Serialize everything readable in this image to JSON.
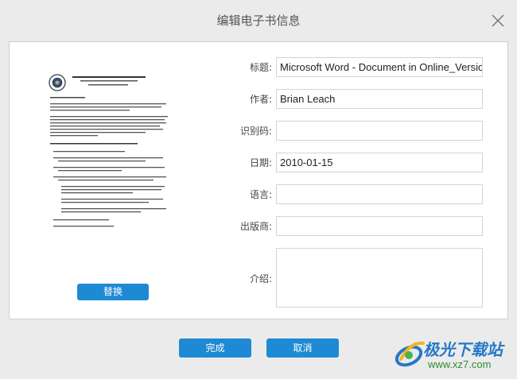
{
  "window": {
    "title": "编辑电子书信息",
    "close_icon": "close-icon"
  },
  "cover": {
    "replace_label": "替换"
  },
  "fields": {
    "title_label": "标题:",
    "title_value": "Microsoft Word - Document in Online_Version_I",
    "author_label": "作者:",
    "author_value": "Brian Leach",
    "id_label": "识别码:",
    "id_value": "",
    "date_label": "日期:",
    "date_value": "2010-01-15",
    "language_label": "语言:",
    "language_value": "",
    "publisher_label": "出版商:",
    "publisher_value": "",
    "intro_label": "介绍:",
    "intro_value": ""
  },
  "footer": {
    "done_label": "完成",
    "cancel_label": "取消"
  },
  "watermark": {
    "title": "极光下载站",
    "url": "www.xz7.com"
  },
  "colors": {
    "accent": "#1f8ad4",
    "background": "#ebebeb",
    "panel": "#ffffff"
  }
}
